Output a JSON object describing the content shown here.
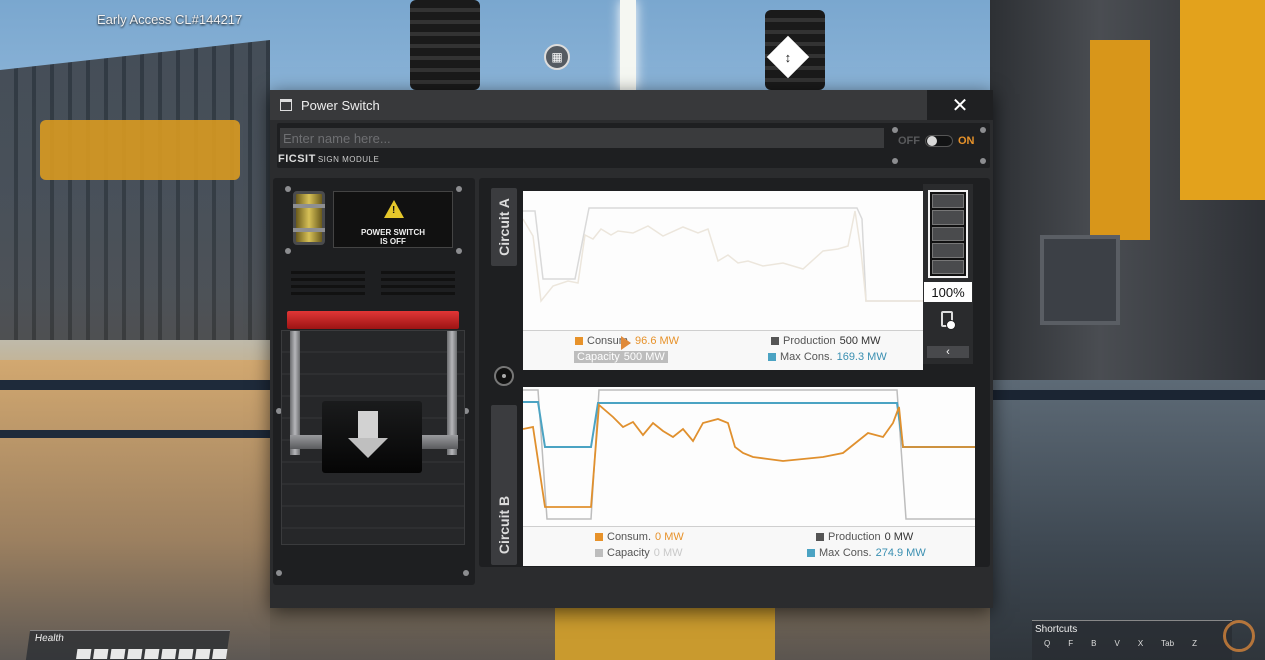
{
  "game": {
    "version": "Early Access CL#144217"
  },
  "hud": {
    "health_label": "Health",
    "shortcuts_label": "Shortcuts",
    "shortcut_keys": [
      "Q",
      "F",
      "B",
      "V",
      "X",
      "Tab",
      "Z"
    ]
  },
  "window": {
    "title": "Power Switch",
    "close_label": "✕"
  },
  "sign_module": {
    "name_placeholder": "Enter name here...",
    "name_value": "",
    "brand": "FICSIT",
    "module_label": "SIGN MODULE",
    "toggle_off": "OFF",
    "toggle_on": "ON",
    "toggle_state": "off"
  },
  "switch_panel": {
    "status_icon": "warning-icon",
    "status_line1": "POWER SWITCH",
    "status_line2": "IS OFF",
    "lever_state": "down"
  },
  "circuit_a": {
    "tab_label": "Circuit A",
    "consum_label": "Consum.",
    "consum_value": "96.6 MW",
    "production_label": "Production",
    "production_value": "500 MW",
    "capacity_label": "Capacity",
    "capacity_value": "500 MW",
    "maxcons_label": "Max Cons.",
    "maxcons_value": "169.3 MW",
    "battery_percent": "100%",
    "battery_toggle": "‹",
    "colors": {
      "consumption": "#e7922a",
      "production": "#555555",
      "capacity": "#bdbdbd",
      "max_consumption": "#4ba3c3"
    }
  },
  "circuit_b": {
    "tab_label": "Circuit B",
    "consum_label": "Consum.",
    "consum_value": "0 MW",
    "production_label": "Production",
    "production_value": "0 MW",
    "capacity_label": "Capacity",
    "capacity_value": "0 MW",
    "maxcons_label": "Max Cons.",
    "maxcons_value": "274.9 MW",
    "colors": {
      "consumption": "#e7922a",
      "production": "#555555",
      "capacity": "#bdbdbd",
      "max_consumption": "#4ba3c3"
    }
  }
}
